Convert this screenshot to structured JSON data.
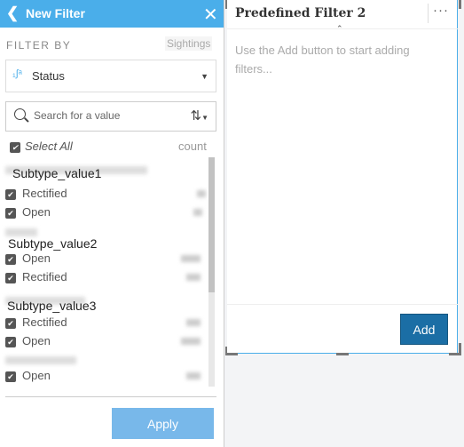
{
  "panel": {
    "title": "New Filter",
    "back_icon": "chevron-left-icon",
    "close_icon": "close-icon",
    "filter_by_label": "FILTER BY",
    "dataset": "Sightings",
    "field": "Status",
    "field_icon": "string-field-icon",
    "search_placeholder": "Search for a value",
    "select_all": "Select All",
    "count_label": "count",
    "apply": "Apply",
    "groups": [
      {
        "name": "Subtype_value1",
        "items": [
          "Rectified",
          "Open"
        ]
      },
      {
        "name": "Subtype_value2",
        "items": [
          "Open",
          "Rectified"
        ]
      },
      {
        "name": "Subtype_value3",
        "items": [
          "Rectified",
          "Open"
        ]
      },
      {
        "name": "",
        "items": [
          "Open"
        ]
      }
    ]
  },
  "card": {
    "title": "Predefined Filter 2",
    "more_icon": "ellipsis-icon",
    "message": "Use the Add button to start adding filters...",
    "add": "Add"
  },
  "colors": {
    "header": "#4aaeea",
    "add_button": "#1b6ea5",
    "apply_button": "#78b8ea"
  }
}
